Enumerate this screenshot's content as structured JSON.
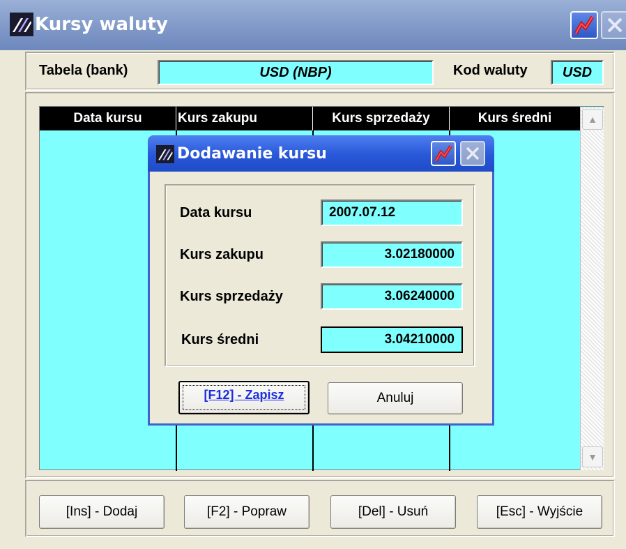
{
  "window": {
    "title": "Kursy waluty"
  },
  "header": {
    "table_label": "Tabela (bank)",
    "table_value": "USD (NBP)",
    "code_label": "Kod waluty",
    "code_value": "USD"
  },
  "grid": {
    "columns": [
      "Data kursu",
      "Kurs zakupu",
      "Kurs sprzedaży",
      "Kurs średni"
    ]
  },
  "footer": {
    "add_label": "[Ins] - Dodaj",
    "edit_label": "[F2] - Popraw",
    "delete_label": "[Del] - Usuń",
    "exit_label": "[Esc] - Wyjście"
  },
  "dialog": {
    "title": "Dodawanie kursu",
    "fields": [
      {
        "label": "Data kursu",
        "value": "2007.07.12"
      },
      {
        "label": "Kurs zakupu",
        "value": "3.02180000"
      },
      {
        "label": "Kurs sprzedaży",
        "value": "3.06240000"
      },
      {
        "label": "Kurs średni",
        "value": "3.04210000"
      }
    ],
    "save_label": "[F12] - Zapisz",
    "cancel_label": "Anuluj"
  },
  "colors": {
    "field_bg": "#80ffff",
    "title_bar": "#7e97c7",
    "dialog_title": "#2857d8"
  }
}
